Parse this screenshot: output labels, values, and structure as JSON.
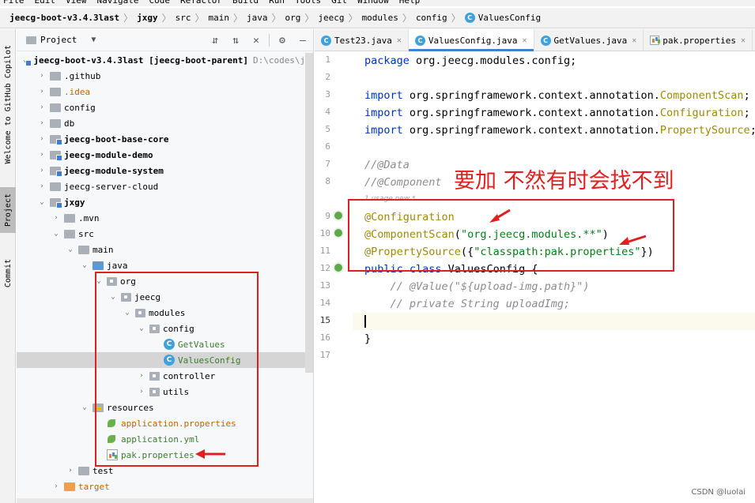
{
  "menubar": {
    "items": [
      "File",
      "Edit",
      "View",
      "Navigate",
      "Code",
      "Refactor",
      "Build",
      "Run",
      "Tools",
      "Git",
      "Window",
      "Help"
    ]
  },
  "breadcrumb": {
    "items": [
      "jeecg-boot-v3.4.3last",
      "jxgy",
      "src",
      "main",
      "java",
      "org",
      "jeecg",
      "modules",
      "config",
      "ValuesConfig"
    ]
  },
  "left_strip": {
    "copilot": "Welcome to GitHub Copilot",
    "project": "Project",
    "commit": "Commit"
  },
  "project_panel": {
    "title": "Project",
    "root_path": "D:\\codes\\jeec"
  },
  "tree": [
    {
      "label": "jeecg-boot-v3.4.3last [jeecg-boot-parent]"
    },
    {
      "label": ".github"
    },
    {
      "label": ".idea"
    },
    {
      "label": "config"
    },
    {
      "label": "db"
    },
    {
      "label": "jeecg-boot-base-core"
    },
    {
      "label": "jeecg-module-demo"
    },
    {
      "label": "jeecg-module-system"
    },
    {
      "label": "jeecg-server-cloud"
    },
    {
      "label": "jxgy"
    },
    {
      "label": ".mvn"
    },
    {
      "label": "src"
    },
    {
      "label": "main"
    },
    {
      "label": "java"
    },
    {
      "label": "org"
    },
    {
      "label": "jeecg"
    },
    {
      "label": "modules"
    },
    {
      "label": "config"
    },
    {
      "label": "GetValues"
    },
    {
      "label": "ValuesConfig"
    },
    {
      "label": "controller"
    },
    {
      "label": "utils"
    },
    {
      "label": "resources"
    },
    {
      "label": "application.properties"
    },
    {
      "label": "application.yml"
    },
    {
      "label": "pak.properties"
    },
    {
      "label": "test"
    },
    {
      "label": "target"
    }
  ],
  "editor_tabs": [
    {
      "label": "Test23.java"
    },
    {
      "label": "ValuesConfig.java"
    },
    {
      "label": "GetValues.java"
    },
    {
      "label": "pak.properties"
    }
  ],
  "code": {
    "line_numbers": [
      "1",
      "2",
      "3",
      "4",
      "5",
      "6",
      "7",
      "8",
      "9",
      "10",
      "11",
      "12",
      "13",
      "14",
      "15",
      "16",
      "17"
    ],
    "l1": {
      "kw": "package",
      "rest": " org.jeecg.modules.config;"
    },
    "l3": {
      "kw": "import",
      "pkg": " org.springframework.context.annotation.",
      "cls": "ComponentScan",
      "end": ";"
    },
    "l4": {
      "kw": "import",
      "pkg": " org.springframework.context.annotation.",
      "cls": "Configuration",
      "end": ";"
    },
    "l5": {
      "kw": "import",
      "pkg": " org.springframework.context.annotation.",
      "cls": "PropertySource",
      "end": ";"
    },
    "l7": "//@Data",
    "l8": "//@Component",
    "usage_hint": "1 usage  new *",
    "l9": "@Configuration",
    "l10": {
      "ann": "@ComponentScan",
      "open": "(",
      "str": "\"org.jeecg.modules.**\"",
      "close": ")"
    },
    "l11": {
      "ann": "@PropertySource",
      "open": "({",
      "str": "\"classpath:pak.properties\"",
      "close": "})"
    },
    "l12": {
      "kw": "public class",
      "rest": " ValuesConfig {"
    },
    "l13": "    // @Value(\"${upload-img.path}\")",
    "l14": "    // private String uploadImg;",
    "l16": "}"
  },
  "annotation": {
    "text": "要加  不然有时会找不到",
    "color": "#e02020"
  },
  "watermark": "CSDN @luolai",
  "colors": {
    "keyword": "#0033b3",
    "annotation": "#9e880d",
    "string": "#067d17",
    "comment": "#8c8c8c",
    "tab_underline": "#4083c9"
  }
}
